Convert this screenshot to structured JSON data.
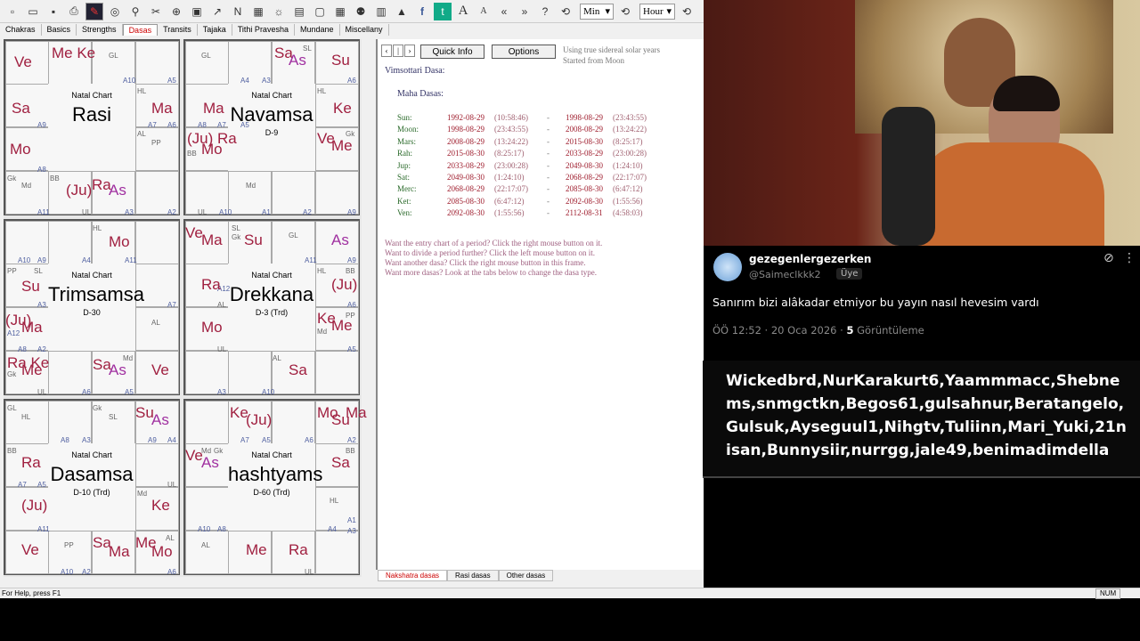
{
  "toolbar": {
    "combo1": "Min",
    "combo2": "Hour"
  },
  "tabs": [
    "Chakras",
    "Basics",
    "Strengths",
    "Dasas",
    "Transits",
    "Tajaka",
    "Tithi Pravesha",
    "Mundane",
    "Miscellany"
  ],
  "charts": [
    {
      "nc": "Natal Chart",
      "name": "Rasi",
      "sub": ""
    },
    {
      "nc": "Natal Chart",
      "name": "Navamsa",
      "sub": "D-9"
    },
    {
      "nc": "Natal Chart",
      "name": "Trimsamsa",
      "sub": "D-30"
    },
    {
      "nc": "Natal Chart",
      "name": "Drekkana",
      "sub": "D-3 (Trd)"
    },
    {
      "nc": "Natal Chart",
      "name": "Dasamsa",
      "sub": "D-10 (Trd)"
    },
    {
      "nc": "Natal Chart",
      "name": "hashtyams",
      "sub": "D-60 (Trd)"
    }
  ],
  "dasa": {
    "quick_info": "Quick Info",
    "options": "Options",
    "info1": "Using true sidereal solar years",
    "info2": "Started from Moon",
    "title": "Vimsottari Dasa:",
    "maha": "Maha Dasas:",
    "rows": [
      {
        "p": "Sun:",
        "s": "1992-08-29",
        "st": "(10:58:46)",
        "e": "1998-08-29",
        "et": "(23:43:55)"
      },
      {
        "p": "Moon:",
        "s": "1998-08-29",
        "st": "(23:43:55)",
        "e": "2008-08-29",
        "et": "(13:24:22)"
      },
      {
        "p": "Mars:",
        "s": "2008-08-29",
        "st": "(13:24:22)",
        "e": "2015-08-30",
        "et": "(8:25:17)"
      },
      {
        "p": "Rah:",
        "s": "2015-08-30",
        "st": "(8:25:17)",
        "e": "2033-08-29",
        "et": "(23:00:28)"
      },
      {
        "p": "Jup:",
        "s": "2033-08-29",
        "st": "(23:00:28)",
        "e": "2049-08-30",
        "et": "(1:24:10)"
      },
      {
        "p": "Sat:",
        "s": "2049-08-30",
        "st": "(1:24:10)",
        "e": "2068-08-29",
        "et": "(22:17:07)"
      },
      {
        "p": "Merc:",
        "s": "2068-08-29",
        "st": "(22:17:07)",
        "e": "2085-08-30",
        "et": "(6:47:12)"
      },
      {
        "p": "Ket:",
        "s": "2085-08-30",
        "st": "(6:47:12)",
        "e": "2092-08-30",
        "et": "(1:55:56)"
      },
      {
        "p": "Ven:",
        "s": "2092-08-30",
        "st": "(1:55:56)",
        "e": "2112-08-31",
        "et": "(4:58:03)"
      }
    ],
    "notes": [
      "Want the entry chart of a period? Click the right mouse button on it.",
      "Want to divide a period further? Click the left mouse button on it.",
      "Want another dasa? Click the right mouse button in this frame.",
      "Want more dasas? Look at the tabs below to change the dasa type."
    ]
  },
  "bottom_tabs": [
    "Nakshatra dasas",
    "Rasi dasas",
    "Other dasas"
  ],
  "status": {
    "help": "For Help, press F1",
    "num": "NUM"
  },
  "tweet": {
    "name": "gezegenlergezerken",
    "handle": "@Saimeclkkk2",
    "badge": "Üye",
    "text": "Sanırım bizi alâkadar etmiyor bu yayın nasıl hevesim vardı",
    "time": "ÖÖ 12:52 · 20 Oca 2026 · ",
    "views_num": "5",
    "views": "Görüntüleme"
  },
  "chat": "Wickedbrd,NurKarakurt6,Yaammmacc,Shebnems,snmgctkn,Begos61,gulsahnur,Beratangelo,Gulsuk,Ayseguul1,Nihgtv,Tuliinn,Mari_Yuki,21nisan,Bunnysiir,nurrgg,jale49,benimadimdella"
}
